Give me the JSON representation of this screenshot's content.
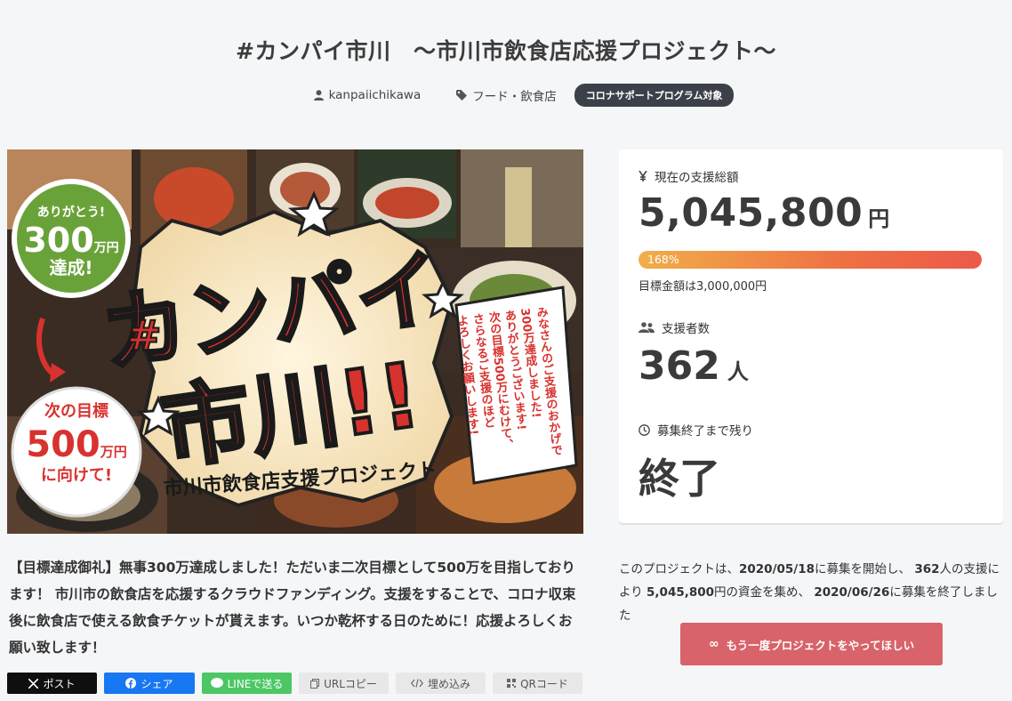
{
  "title": "#カンパイ市川　〜市川市飲食店応援プロジェクト〜",
  "meta": {
    "owner": "kanpaiichikawa",
    "category": "フード・飲食店",
    "badge": "コロナサポートプログラム対象"
  },
  "hero": {
    "badge_top_line1": "ありがとう!",
    "badge_top_num": "300",
    "badge_top_unit": "万円",
    "badge_top_line3": "達成!",
    "badge_bottom_line1": "次の目標",
    "badge_bottom_num": "500",
    "badge_bottom_unit": "万円",
    "badge_bottom_line3": "に向けて!",
    "headline": "カンパイ 市川!!",
    "subtitle": "市川市飲食店支援プロジェクト",
    "vertical_message": "みなさんのご支援のおかげで 300万達成しました! ありがとうございます! 次の目標500万にむけて、 さらなるご支援のほど よろしくお願いします!"
  },
  "description": "【目標達成御礼】無事300万達成しました！ただいま二次目標として500万を目指しております！ 市川市の飲食店を応援するクラウドファンディング。支援をすることで、コロナ収束後に飲食店で使える飲食チケットが貰えます。いつか乾杯する日のために！応援よろしくお願い致します！",
  "share": {
    "x": "ポスト",
    "facebook": "シェア",
    "line": "LINEで送る",
    "url": "URLコピー",
    "embed": "埋め込み",
    "qr": "QRコード"
  },
  "stats": {
    "amount_label": "現在の支援総額",
    "amount": "5,045,800",
    "amount_unit": "円",
    "percent_text": "168%",
    "progress": 1.0,
    "goal_text": "目標金額は3,000,000円",
    "backers_label": "支援者数",
    "backers": "362",
    "backers_unit": "人",
    "remain_label": "募集終了まで残り",
    "remain": "終了"
  },
  "summary": {
    "p1": "このプロジェクトは、",
    "start": "2020/05/18",
    "p2": "に募集を開始し、 ",
    "backers": "362",
    "p3": "人の支援により ",
    "amount": "5,045,800",
    "p4": "円の資金を集め、 ",
    "end": "2020/06/26",
    "p5": "に募集を終了しました"
  },
  "again_button": "もう一度プロジェクトをやってほしい",
  "colors": {
    "badge_bg": "#3b4049",
    "progress_start": "#f0ae4a",
    "progress_end": "#ec5a4a",
    "again_bg": "#d9636a",
    "x_bg": "#0f0f0f",
    "facebook_bg": "#1877f2",
    "line_bg": "#4cc764"
  }
}
